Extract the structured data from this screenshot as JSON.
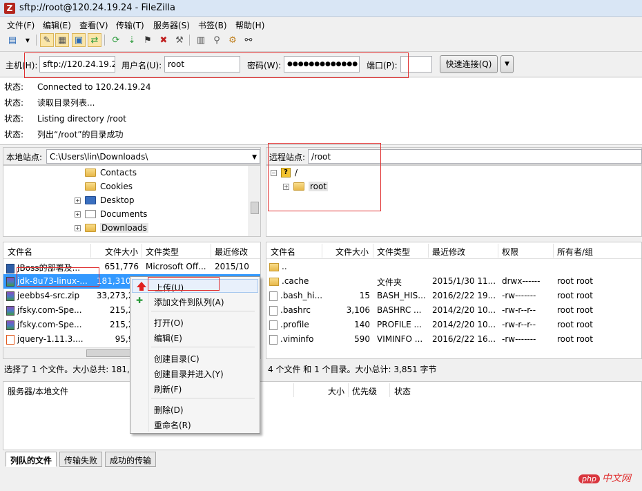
{
  "window": {
    "title": "sftp://root@120.24.19.24 - FileZilla",
    "app_icon": "Z"
  },
  "menu": [
    "文件(F)",
    "编辑(E)",
    "查看(V)",
    "传输(T)",
    "服务器(S)",
    "书签(B)",
    "帮助(H)"
  ],
  "quickconnect": {
    "host_label": "主机(H):",
    "host_value": "sftp://120.24.19.24",
    "user_label": "用户名(U):",
    "user_value": "root",
    "pass_label": "密码(W):",
    "pass_value": "●●●●●●●●●●●●●",
    "port_label": "端口(P):",
    "port_value": "",
    "connect_label": "快速连接(Q)",
    "dropdown": "▼"
  },
  "log": [
    {
      "key": "状态:",
      "text": "Connected to 120.24.19.24"
    },
    {
      "key": "状态:",
      "text": "读取目录列表..."
    },
    {
      "key": "状态:",
      "text": "Listing directory /root"
    },
    {
      "key": "状态:",
      "text": "列出“/root”的目录成功"
    }
  ],
  "local": {
    "site_label": "本地站点:",
    "path": "C:\\Users\\lin\\Downloads\\",
    "tree": [
      {
        "name": "Contacts",
        "expander": ""
      },
      {
        "name": "Cookies",
        "expander": ""
      },
      {
        "name": "Desktop",
        "expander": "+"
      },
      {
        "name": "Documents",
        "expander": "+"
      },
      {
        "name": "Downloads",
        "expander": "+"
      }
    ],
    "headers": [
      "文件名",
      "文件大小",
      "文件类型",
      "最近修改"
    ],
    "files": [
      {
        "name": "JBoss的部署及...",
        "size": "651,776",
        "type": "Microsoft Off...",
        "modified": "2015/10,",
        "icon": "doc-icon"
      },
      {
        "name": "jdk-8u73-linux-...",
        "size": "181,310,7",
        "type": "",
        "modified": "",
        "icon": "archive-icon"
      },
      {
        "name": "jeebbs4-src.zip",
        "size": "33,273,27",
        "type": "",
        "modified": "",
        "icon": "archive-icon"
      },
      {
        "name": "jfsky.com-Spe...",
        "size": "215,27",
        "type": "",
        "modified": "",
        "icon": "archive-icon"
      },
      {
        "name": "jfsky.com-Spe...",
        "size": "215,27",
        "type": "",
        "modified": "",
        "icon": "archive-icon"
      },
      {
        "name": "jquery-1.11.3....",
        "size": "95,95",
        "type": "",
        "modified": "",
        "icon": "jar-icon"
      }
    ],
    "status": "选择了 1 个文件。大小总共: 181,3"
  },
  "remote": {
    "site_label": "远程站点:",
    "path": "/root",
    "tree": [
      {
        "name": "/",
        "expander": "−"
      },
      {
        "name": "root",
        "expander": "+"
      }
    ],
    "headers": [
      "文件名",
      "文件大小",
      "文件类型",
      "最近修改",
      "权限",
      "所有者/组"
    ],
    "files": [
      {
        "name": "..",
        "size": "",
        "type": "",
        "modified": "",
        "perm": "",
        "owner": "",
        "icon": "folder-icon"
      },
      {
        "name": ".cache",
        "size": "",
        "type": "文件夹",
        "modified": "2015/1/30 11...",
        "perm": "drwx------",
        "owner": "root root",
        "icon": "folder-icon"
      },
      {
        "name": ".bash_hi...",
        "size": "15",
        "type": "BASH_HIS...",
        "modified": "2016/2/22 19...",
        "perm": "-rw-------",
        "owner": "root root",
        "icon": "file-icon"
      },
      {
        "name": ".bashrc",
        "size": "3,106",
        "type": "BASHRC ...",
        "modified": "2014/2/20 10...",
        "perm": "-rw-r--r--",
        "owner": "root root",
        "icon": "file-icon"
      },
      {
        "name": ".profile",
        "size": "140",
        "type": "PROFILE ...",
        "modified": "2014/2/20 10...",
        "perm": "-rw-r--r--",
        "owner": "root root",
        "icon": "file-icon"
      },
      {
        "name": ".viminfo",
        "size": "590",
        "type": "VIMINFO ...",
        "modified": "2016/2/22 16...",
        "perm": "-rw-------",
        "owner": "root root",
        "icon": "file-icon"
      }
    ],
    "status": "4 个文件 和 1 个目录。大小总计: 3,851 字节"
  },
  "queue": {
    "headers": [
      "服务器/本地文件",
      "大小",
      "优先级",
      "状态"
    ],
    "tabs": [
      "列队的文件",
      "传输失败",
      "成功的传输"
    ]
  },
  "context_menu": {
    "items": [
      "上传(U)",
      "添加文件到队列(A)",
      "打开(O)",
      "编辑(E)",
      "创建目录(C)",
      "创建目录并进入(Y)",
      "刷新(F)",
      "删除(D)",
      "重命名(R)"
    ]
  },
  "watermark": {
    "badge": "php",
    "text": "中文网"
  },
  "colors": {
    "selection": "#3399ff",
    "annotation": "#e03030"
  }
}
